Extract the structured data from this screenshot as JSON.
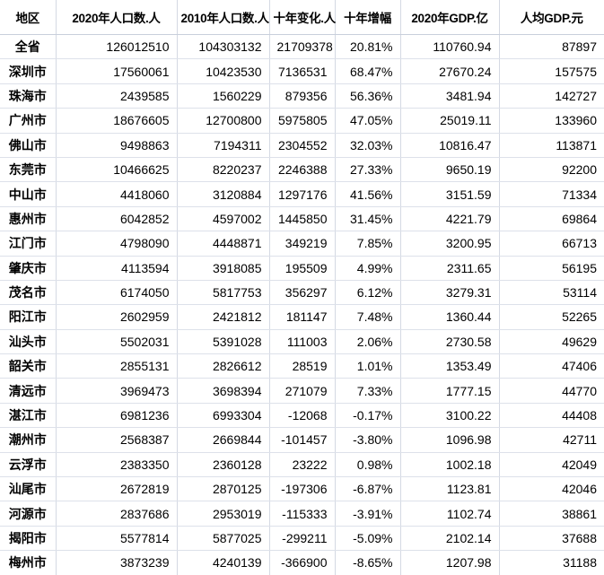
{
  "table": {
    "columns": [
      {
        "key": "region",
        "label": "地区",
        "align": "center"
      },
      {
        "key": "pop2020",
        "label": "2020年人口数.人",
        "align": "right"
      },
      {
        "key": "pop2010",
        "label": "2010年人口数.人",
        "align": "right"
      },
      {
        "key": "change",
        "label": "十年变化.人",
        "align": "right"
      },
      {
        "key": "growth",
        "label": "十年增幅",
        "align": "right"
      },
      {
        "key": "gdp2020",
        "label": "2020年GDP.亿",
        "align": "right"
      },
      {
        "key": "pergdp",
        "label": "人均GDP.元",
        "align": "right"
      }
    ],
    "rows": [
      {
        "region": "全省",
        "pop2020": "126012510",
        "pop2010": "104303132",
        "change": "21709378",
        "growth": "20.81%",
        "gdp2020": "110760.94",
        "pergdp": "87897"
      },
      {
        "region": "深圳市",
        "pop2020": "17560061",
        "pop2010": "10423530",
        "change": "7136531",
        "growth": "68.47%",
        "gdp2020": "27670.24",
        "pergdp": "157575"
      },
      {
        "region": "珠海市",
        "pop2020": "2439585",
        "pop2010": "1560229",
        "change": "879356",
        "growth": "56.36%",
        "gdp2020": "3481.94",
        "pergdp": "142727"
      },
      {
        "region": "广州市",
        "pop2020": "18676605",
        "pop2010": "12700800",
        "change": "5975805",
        "growth": "47.05%",
        "gdp2020": "25019.11",
        "pergdp": "133960"
      },
      {
        "region": "佛山市",
        "pop2020": "9498863",
        "pop2010": "7194311",
        "change": "2304552",
        "growth": "32.03%",
        "gdp2020": "10816.47",
        "pergdp": "113871"
      },
      {
        "region": "东莞市",
        "pop2020": "10466625",
        "pop2010": "8220237",
        "change": "2246388",
        "growth": "27.33%",
        "gdp2020": "9650.19",
        "pergdp": "92200"
      },
      {
        "region": "中山市",
        "pop2020": "4418060",
        "pop2010": "3120884",
        "change": "1297176",
        "growth": "41.56%",
        "gdp2020": "3151.59",
        "pergdp": "71334"
      },
      {
        "region": "惠州市",
        "pop2020": "6042852",
        "pop2010": "4597002",
        "change": "1445850",
        "growth": "31.45%",
        "gdp2020": "4221.79",
        "pergdp": "69864"
      },
      {
        "region": "江门市",
        "pop2020": "4798090",
        "pop2010": "4448871",
        "change": "349219",
        "growth": "7.85%",
        "gdp2020": "3200.95",
        "pergdp": "66713"
      },
      {
        "region": "肇庆市",
        "pop2020": "4113594",
        "pop2010": "3918085",
        "change": "195509",
        "growth": "4.99%",
        "gdp2020": "2311.65",
        "pergdp": "56195"
      },
      {
        "region": "茂名市",
        "pop2020": "6174050",
        "pop2010": "5817753",
        "change": "356297",
        "growth": "6.12%",
        "gdp2020": "3279.31",
        "pergdp": "53114"
      },
      {
        "region": "阳江市",
        "pop2020": "2602959",
        "pop2010": "2421812",
        "change": "181147",
        "growth": "7.48%",
        "gdp2020": "1360.44",
        "pergdp": "52265"
      },
      {
        "region": "汕头市",
        "pop2020": "5502031",
        "pop2010": "5391028",
        "change": "111003",
        "growth": "2.06%",
        "gdp2020": "2730.58",
        "pergdp": "49629"
      },
      {
        "region": "韶关市",
        "pop2020": "2855131",
        "pop2010": "2826612",
        "change": "28519",
        "growth": "1.01%",
        "gdp2020": "1353.49",
        "pergdp": "47406"
      },
      {
        "region": "清远市",
        "pop2020": "3969473",
        "pop2010": "3698394",
        "change": "271079",
        "growth": "7.33%",
        "gdp2020": "1777.15",
        "pergdp": "44770"
      },
      {
        "region": "湛江市",
        "pop2020": "6981236",
        "pop2010": "6993304",
        "change": "-12068",
        "growth": "-0.17%",
        "gdp2020": "3100.22",
        "pergdp": "44408"
      },
      {
        "region": "潮州市",
        "pop2020": "2568387",
        "pop2010": "2669844",
        "change": "-101457",
        "growth": "-3.80%",
        "gdp2020": "1096.98",
        "pergdp": "42711"
      },
      {
        "region": "云浮市",
        "pop2020": "2383350",
        "pop2010": "2360128",
        "change": "23222",
        "growth": "0.98%",
        "gdp2020": "1002.18",
        "pergdp": "42049"
      },
      {
        "region": "汕尾市",
        "pop2020": "2672819",
        "pop2010": "2870125",
        "change": "-197306",
        "growth": "-6.87%",
        "gdp2020": "1123.81",
        "pergdp": "42046"
      },
      {
        "region": "河源市",
        "pop2020": "2837686",
        "pop2010": "2953019",
        "change": "-115333",
        "growth": "-3.91%",
        "gdp2020": "1102.74",
        "pergdp": "38861"
      },
      {
        "region": "揭阳市",
        "pop2020": "5577814",
        "pop2010": "5877025",
        "change": "-299211",
        "growth": "-5.09%",
        "gdp2020": "2102.14",
        "pergdp": "37688"
      },
      {
        "region": "梅州市",
        "pop2020": "3873239",
        "pop2010": "4240139",
        "change": "-366900",
        "growth": "-8.65%",
        "gdp2020": "1207.98",
        "pergdp": "31188"
      }
    ]
  },
  "colors": {
    "text": "#000000",
    "header_rule": "#c9cfdb",
    "row_rule": "#dde1ea",
    "col_rule": "#d4d9e3",
    "background": "#ffffff"
  }
}
